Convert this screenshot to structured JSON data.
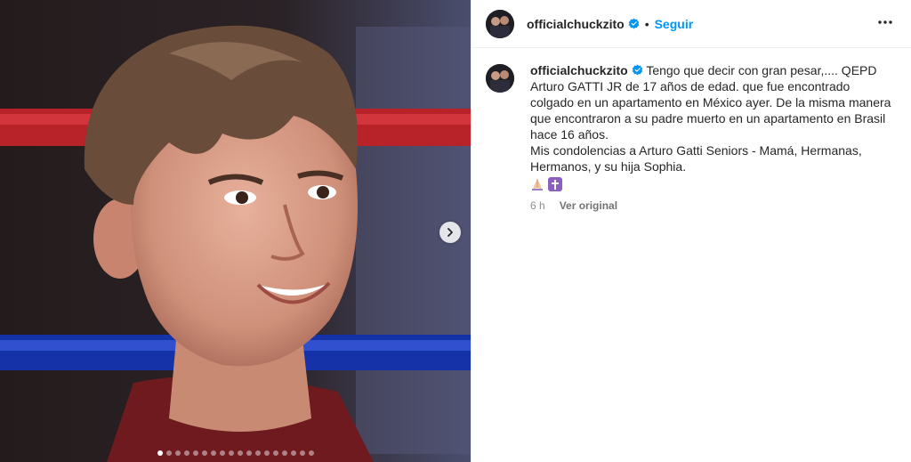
{
  "post": {
    "username": "officialchuckzito",
    "follow_label": "Seguir",
    "separator": "•",
    "caption_lines": [
      "Tengo que decir con gran pesar,.... QEPD",
      "Arturo GATTI JR de 17 años de edad. que fue encontrado",
      "colgado en un apartamento en México ayer. De la misma manera",
      "que encontraron a su padre muerto en un apartamento en Brasil",
      "hace 16 años.",
      "Mis condolencias a Arturo Gatti Seniors - Mamá, Hermanas,",
      "Hermanos, y su hija Sophia."
    ],
    "time_ago": "6 h",
    "see_original": "Ver original"
  },
  "icons": {
    "verified": "verified-badge-icon",
    "more": "more-options-icon",
    "next": "chevron-right-icon",
    "emoji_1": "praying-hands-emoji",
    "emoji_2": "latin-cross-emoji"
  },
  "carousel": {
    "count": 18,
    "active_index": 0
  },
  "colors": {
    "accent": "#0095f6",
    "verified": "#0095f6",
    "text": "#262626",
    "muted": "#8e8e8e"
  }
}
